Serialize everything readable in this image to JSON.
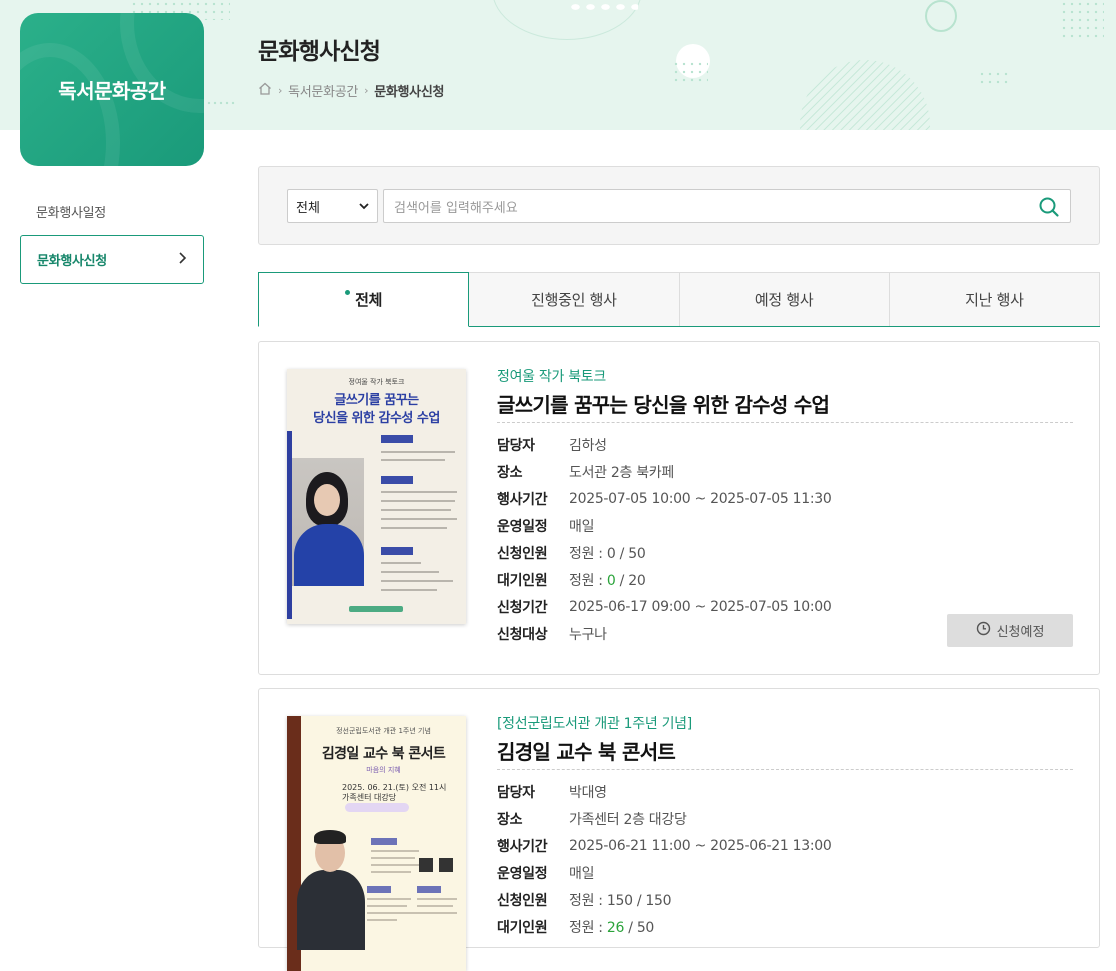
{
  "sidebar": {
    "logo_title": "독서문화공간",
    "items": [
      {
        "label": "문화행사일정",
        "active": false
      },
      {
        "label": "문화행사신청",
        "active": true
      }
    ]
  },
  "header": {
    "page_title": "문화행사신청",
    "breadcrumb": [
      "home-icon",
      "독서문화공간",
      "문화행사신청"
    ]
  },
  "search": {
    "select_value": "전체",
    "placeholder": "검색어를 입력해주세요"
  },
  "tabs": [
    {
      "label": "전체",
      "active": true
    },
    {
      "label": "진행중인 행사",
      "active": false
    },
    {
      "label": "예정 행사",
      "active": false
    },
    {
      "label": "지난 행사",
      "active": false
    }
  ],
  "labels": {
    "manager": "담당자",
    "place": "장소",
    "period": "행사기간",
    "schedule": "운영일정",
    "applicants": "신청인원",
    "waiting": "대기인원",
    "apply_period": "신청기간",
    "target": "신청대상"
  },
  "events": [
    {
      "subtitle": "정여울 작가 북토크",
      "title": "글쓰기를 꿈꾸는 당신을 위한 감수성 수업",
      "manager": "김하성",
      "place": "도서관 2층 북카페",
      "period": "2025-07-05 10:00 ~ 2025-07-05 11:30",
      "schedule": "매일",
      "applicants_prefix": "정원 : ",
      "applicants_current": "0",
      "applicants_max": " / 50",
      "waiting_prefix": "정원 : ",
      "waiting_current": "0",
      "waiting_max": " / 20",
      "apply_period": "2025-06-17 09:00 ~ 2025-07-05 10:00",
      "target": "누구나",
      "status": "신청예정",
      "poster": {
        "header": "정여울 작가 북토크",
        "line1": "글쓰기를 꿈꾸는",
        "line2": "당신을 위한 감수성 수업"
      }
    },
    {
      "subtitle": "[정선군립도서관 개관 1주년 기념]",
      "title": "김경일 교수 북 콘서트",
      "manager": "박대영",
      "place": "가족센터 2층 대강당",
      "period": "2025-06-21 11:00 ~ 2025-06-21 13:00",
      "schedule": "매일",
      "applicants_prefix": "정원 : ",
      "applicants_current": "150",
      "applicants_max": " / 150",
      "waiting_prefix": "정원 : ",
      "waiting_current": "26",
      "waiting_max": " / 50",
      "poster": {
        "header": "정선군립도서관 개관 1주년 기념",
        "title": "김경일 교수 북 콘서트",
        "sub": "마음의 지혜",
        "date": "2025. 06. 21.(토) 오전 11시",
        "place": "가족센터 대강당"
      }
    }
  ],
  "colors": {
    "accent": "#1a9a7a",
    "header_bg": "#e6f5ee",
    "highlight_green": "#2aa33a"
  }
}
